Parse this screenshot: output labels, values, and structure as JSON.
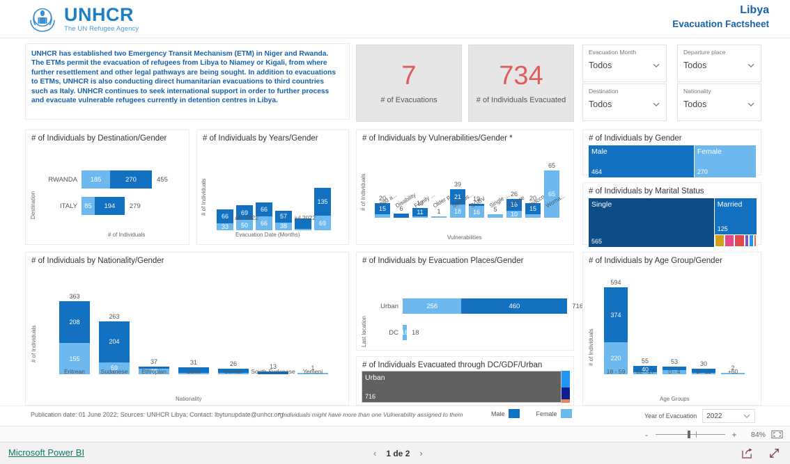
{
  "header": {
    "logo_title": "UNHCR",
    "logo_sub": "The UN Refugee Agency",
    "logo_icon": "unhcr-logo-icon",
    "title_main": "Libya",
    "title_sub": "Evacuation Factsheet"
  },
  "intro": {
    "text": "UNHCR has established two Emergency Transit Mechanism (ETM) in Niger and Rwanda. The ETMs permit the evacuation of refugees from Libya to Niamey or Kigali, from where further resettlement and other legal pathways are being sought. In addition to evacuations to ETMs, UNHCR is also conducting direct humanitarian evacuations to third countries such as Italy. UNHCR continues to seek international support in order to further process and evacuate vulnerable refugees currently in detention centres in Libya."
  },
  "kpis": [
    {
      "value": "7",
      "label": "# of Evacuations"
    },
    {
      "value": "734",
      "label": "# of Individuals Evacuated"
    }
  ],
  "slicers": [
    {
      "label": "Evacuation Month",
      "value": "Todos"
    },
    {
      "label": "Departure place",
      "value": "Todos"
    },
    {
      "label": "Destination",
      "value": "Todos"
    },
    {
      "label": "Nationality",
      "value": "Todos"
    }
  ],
  "footer": {
    "note": "Publication date: 01 June 2022; Sources: UNHCR Libya; Contact: lbytunupdate@unhcr.org",
    "star_note": "* Individuals might have more than one Vulnerability assigned to them",
    "legend": [
      {
        "label": "Male",
        "color": "#1271c0"
      },
      {
        "label": "Female",
        "color": "#6cb8ef"
      }
    ],
    "year_label": "Year of Evacuation",
    "year_value": "2022"
  },
  "chrome": {
    "zoom_pct": "84%",
    "zoom_minus": "-",
    "zoom_plus": "+",
    "pbi_link": "Microsoft Power BI",
    "page_text": "1 de 2",
    "prev_arrow": "‹",
    "next_arrow": "›"
  },
  "colors": {
    "male": "#1271c0",
    "female": "#6cb8ef",
    "kpi": "#e05c5c",
    "brand": "#1662ac"
  },
  "chart_data": [
    {
      "id": "destination",
      "type": "bar",
      "orientation": "horizontal",
      "title": "# of Individuals by Destination/Gender",
      "xlabel": "# of Individuals",
      "ylabel": "Destination",
      "categories": [
        "RWANDA",
        "ITALY"
      ],
      "series": [
        {
          "name": "Female",
          "values": [
            185,
            85
          ]
        },
        {
          "name": "Male",
          "values": [
            270,
            194
          ]
        }
      ],
      "totals": [
        455,
        279
      ]
    },
    {
      "id": "years",
      "type": "bar",
      "orientation": "vertical",
      "stacked": true,
      "title": "# of Individuals by Years/Gender",
      "xlabel": "Evacuation Date (Months)",
      "ylabel": "# of Individuals",
      "categories": [
        "",
        "abr 2022",
        "",
        "",
        "jul 2022",
        ""
      ],
      "tick_labels": [
        "abr 2022",
        "jul 2022"
      ],
      "series": [
        {
          "name": "Male",
          "values": [
            66,
            69,
            66,
            57,
            50,
            135
          ]
        },
        {
          "name": "Female",
          "values": [
            33,
            50,
            66,
            38,
            5,
            69
          ]
        }
      ],
      "labels_male": [
        "66",
        "69",
        "66",
        "57",
        "",
        "135"
      ],
      "labels_female": [
        "33",
        "50",
        "66",
        "38",
        "",
        "69"
      ]
    },
    {
      "id": "vulnerabilities",
      "type": "bar",
      "orientation": "vertical",
      "stacked": true,
      "title": "# of Individuals by Vulnerabilities/Gender *",
      "xlabel": "Vulnerabilities",
      "ylabel": "# of Individuals",
      "categories": [
        "Child a...",
        "Disability",
        "Family ...",
        "Older p...",
        "Serious...",
        "SGBV",
        "Single ...",
        "Torture",
        "Unacco...",
        "Woma..."
      ],
      "totals": [
        20,
        6,
        13,
        1,
        39,
        19,
        5,
        26,
        20,
        65
      ],
      "series": [
        {
          "name": "Male",
          "values": [
            15,
            6,
            11,
            0,
            21,
            3,
            0,
            16,
            15,
            0
          ]
        },
        {
          "name": "Female",
          "values": [
            5,
            0,
            2,
            1,
            18,
            16,
            5,
            10,
            5,
            65
          ]
        }
      ],
      "labels_male": [
        "15",
        "",
        "11",
        "",
        "21",
        "",
        "",
        "16",
        "15",
        ""
      ],
      "labels_female": [
        "",
        "",
        "",
        "",
        "18",
        "16",
        "",
        "10",
        "",
        "65"
      ]
    },
    {
      "id": "gender",
      "type": "treemap",
      "title": "# of Individuals by Gender",
      "tiles": [
        {
          "name": "Male",
          "value": "464",
          "color": "#1271c0"
        },
        {
          "name": "Female",
          "value": "270",
          "color": "#6cb8ef"
        }
      ]
    },
    {
      "id": "marital",
      "type": "treemap",
      "title": "# of Individuals by Marital Status",
      "tiles": [
        {
          "name": "Single",
          "value": "565",
          "color": "#0d4c87"
        },
        {
          "name": "Married",
          "value": "125",
          "color": "#1271c0"
        },
        {
          "name": "",
          "value": "",
          "color": "#d4a017"
        },
        {
          "name": "",
          "value": "",
          "color": "#e8488a"
        },
        {
          "name": "",
          "value": "",
          "color": "#e0494f"
        },
        {
          "name": "",
          "value": "",
          "color": "#7b57c4"
        },
        {
          "name": "",
          "value": "",
          "color": "#2196f3"
        },
        {
          "name": "",
          "value": "",
          "color": "#e87030"
        }
      ]
    },
    {
      "id": "nationality",
      "type": "bar",
      "orientation": "vertical",
      "stacked": true,
      "title": "# of Individuals by Nationality/Gender",
      "xlabel": "Nationality",
      "ylabel": "# of Individuals",
      "categories": [
        "Eritrean",
        "Sudanese",
        "Ethiopian",
        "Other",
        "Somali",
        "South Sudanese",
        "Yemeni"
      ],
      "totals": [
        363,
        263,
        37,
        31,
        26,
        13,
        1
      ],
      "series": [
        {
          "name": "Male",
          "values": [
            208,
            204,
            9,
            27,
            20,
            13,
            0
          ]
        },
        {
          "name": "Female",
          "values": [
            155,
            59,
            28,
            4,
            6,
            0,
            1
          ]
        }
      ],
      "labels_male": [
        "208",
        "204",
        "",
        "",
        "",
        "",
        ""
      ],
      "labels_female": [
        "155",
        "59",
        "28",
        "",
        "",
        "",
        ""
      ]
    },
    {
      "id": "places",
      "type": "bar",
      "orientation": "horizontal",
      "title": "# of Individuals by Evacuation Places/Gender",
      "ylabel": "Last location",
      "categories": [
        "Urban",
        "DC"
      ],
      "series": [
        {
          "name": "Female",
          "values": [
            256,
            18
          ]
        },
        {
          "name": "Male",
          "values": [
            460,
            0
          ]
        }
      ],
      "totals": [
        716,
        18
      ]
    },
    {
      "id": "dcgdf",
      "type": "treemap",
      "title": "# of Individuals Evacuated through DC/GDF/Urban",
      "tiles": [
        {
          "name": "Urban",
          "value": "716",
          "color": "#616161"
        },
        {
          "name": "",
          "value": "",
          "color": "#2196f3"
        },
        {
          "name": "",
          "value": "",
          "color": "#0d1f8c"
        },
        {
          "name": "",
          "value": "",
          "color": "#e8825a"
        }
      ]
    },
    {
      "id": "age",
      "type": "bar",
      "orientation": "vertical",
      "stacked": true,
      "title": "# of Individuals by Age Group/Gender",
      "xlabel": "Age Groups",
      "ylabel": "# of Individuals",
      "categories": [
        "18 - 59",
        "12 - 17",
        "0 - 4",
        "5 - 11",
        "+60"
      ],
      "totals": [
        594,
        55,
        53,
        30,
        2
      ],
      "series": [
        {
          "name": "Male",
          "values": [
            374,
            40,
            22,
            27,
            0
          ]
        },
        {
          "name": "Female",
          "values": [
            220,
            15,
            31,
            3,
            2
          ]
        }
      ],
      "labels_male": [
        "374",
        "40",
        "",
        "",
        ""
      ],
      "labels_female": [
        "220",
        "",
        "",
        "",
        ""
      ]
    }
  ]
}
